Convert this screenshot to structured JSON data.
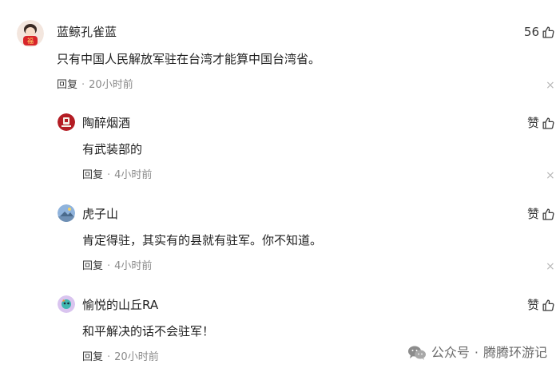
{
  "comments": [
    {
      "username": "蓝鲸孔雀蓝",
      "content": "只有中国人民解放军驻在台湾才能算中国台湾省。",
      "reply_label": "回复",
      "time": "20小时前",
      "like_label": "56"
    },
    {
      "username": "陶醉烟酒",
      "content": "有武装部的",
      "reply_label": "回复",
      "time": "4小时前",
      "like_label": "赞"
    },
    {
      "username": "虎子山",
      "content": "肯定得驻，其实有的县就有驻军。你不知道。",
      "reply_label": "回复",
      "time": "4小时前",
      "like_label": "赞"
    },
    {
      "username": "愉悦的山丘RA",
      "content": "和平解决的话不会驻军！",
      "reply_label": "回复",
      "time": "20小时前",
      "like_label": "赞"
    }
  ],
  "separator": "·",
  "close_symbol": "×",
  "watermark": {
    "prefix": "公众号",
    "separator": "·",
    "account": "腾腾环游记"
  },
  "icons": {
    "like": "thumbs-up-icon",
    "close": "close-icon",
    "wechat": "wechat-icon"
  },
  "colors": {
    "text_primary": "#1f1f1f",
    "text_secondary": "#8a8a8a",
    "close": "#b8b8b8"
  }
}
